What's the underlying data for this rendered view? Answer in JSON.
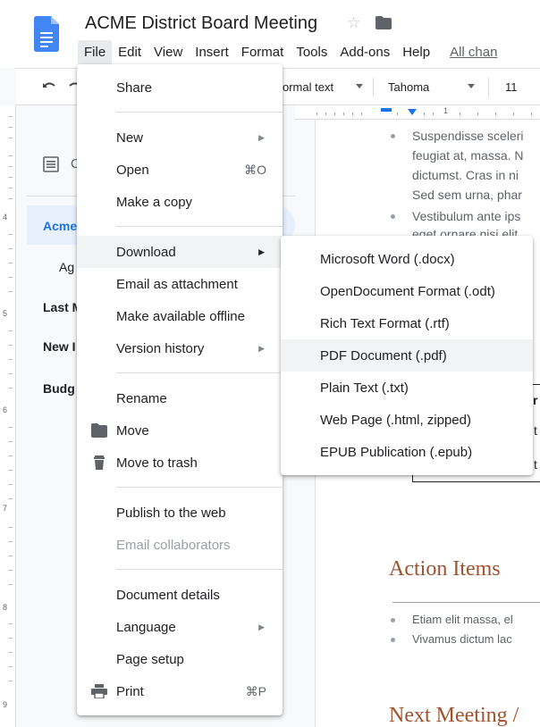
{
  "doc": {
    "title": "ACME District Board Meeting",
    "menus": [
      "File",
      "Edit",
      "View",
      "Insert",
      "Format",
      "Tools",
      "Add-ons",
      "Help"
    ],
    "all_changes": "All chan"
  },
  "toolbar": {
    "style": "ormal text",
    "font": "Tahoma",
    "size": "11"
  },
  "rulers": {
    "vertical": [
      "4",
      "5",
      "6",
      "7",
      "8",
      "9"
    ],
    "horizontal": [
      "1"
    ]
  },
  "outline": {
    "letter": "O",
    "items": [
      "Acme",
      "Ag",
      "Last M",
      "New I",
      "Budg"
    ]
  },
  "page": {
    "bullets_top": [
      "Suspendisse sceleri",
      "feugiat at, massa. N",
      "dictumst. Cras in ni",
      "Sed sem urna, phar",
      "Vestibulum ante ips",
      "eget ornare nisi elit"
    ],
    "table_fragments": [
      "r",
      "t",
      "t"
    ],
    "heading_action": "Action Items",
    "bullets_action": [
      "Etiam elit massa, el",
      "Vivamus dictum lac"
    ],
    "heading_next": "Next Meeting /"
  },
  "file_menu": {
    "items": [
      {
        "label": "Share"
      },
      {
        "label": "New",
        "submenu": true
      },
      {
        "label": "Open",
        "shortcut": "⌘O"
      },
      {
        "label": "Make a copy"
      },
      {
        "label": "Download",
        "submenu": true
      },
      {
        "label": "Email as attachment"
      },
      {
        "label": "Make available offline"
      },
      {
        "label": "Version history",
        "submenu": true
      },
      {
        "label": "Rename"
      },
      {
        "label": "Move"
      },
      {
        "label": "Move to trash"
      },
      {
        "label": "Publish to the web"
      },
      {
        "label": "Email collaborators"
      },
      {
        "label": "Document details"
      },
      {
        "label": "Language",
        "submenu": true
      },
      {
        "label": "Page setup"
      },
      {
        "label": "Print",
        "shortcut": "⌘P"
      }
    ]
  },
  "download_menu": {
    "items": [
      "Microsoft Word (.docx)",
      "OpenDocument Format (.odt)",
      "Rich Text Format (.rtf)",
      "PDF Document (.pdf)",
      "Plain Text (.txt)",
      "Web Page (.html, zipped)",
      "EPUB Publication (.epub)"
    ]
  },
  "colors": {
    "docs_blue": "#4285f4",
    "accent": "#1a73e8",
    "heading": "#a0522d"
  },
  "icons": [
    "docs-icon",
    "star-icon",
    "folder-icon",
    "undo-icon",
    "redo-icon",
    "outline-icon",
    "folder-move-icon",
    "trash-icon",
    "print-icon"
  ]
}
